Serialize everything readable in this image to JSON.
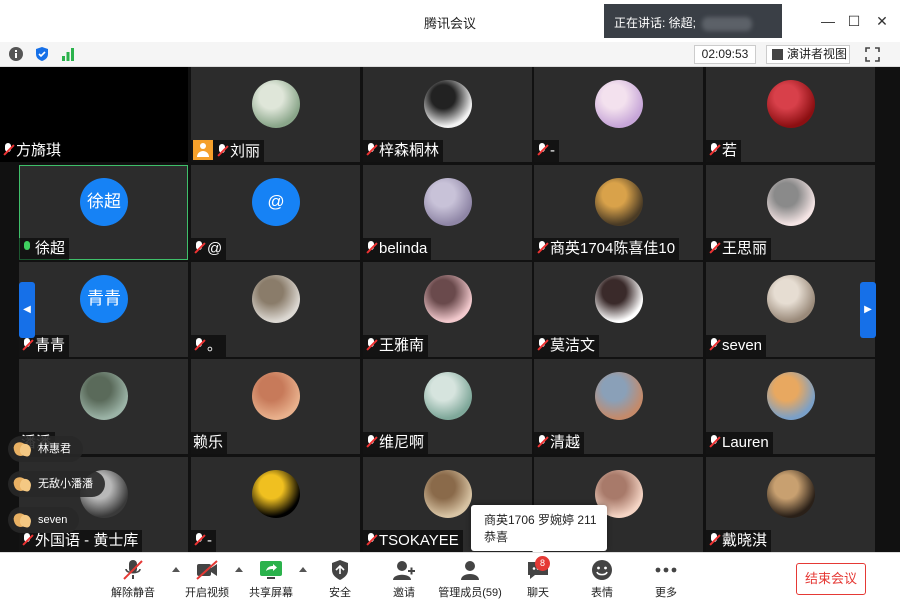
{
  "window": {
    "title": "腾讯会议",
    "speaking_label": "正在讲话: 徐超;"
  },
  "infobar": {
    "timer": "02:09:53",
    "speaker_view_label": "演讲者视图"
  },
  "tiles": [
    {
      "name": "方旖琪",
      "mic": "muted",
      "avatar_type": "none",
      "dark": true
    },
    {
      "name": "刘丽",
      "mic": "muted",
      "avatar_type": "photo",
      "host": true,
      "colors": [
        "#8aa68a",
        "#dfe6d9"
      ]
    },
    {
      "name": "梓森桐林",
      "mic": "muted",
      "avatar_type": "photo",
      "colors": [
        "#f2f2f2",
        "#222"
      ]
    },
    {
      "name": "-",
      "mic": "muted",
      "avatar_type": "photo",
      "colors": [
        "#c7a6d8",
        "#f3e1ee"
      ]
    },
    {
      "name": "若",
      "mic": "muted",
      "avatar_type": "photo",
      "colors": [
        "#8c0f12",
        "#d8404a"
      ]
    },
    {
      "name": "徐超",
      "mic": "on",
      "avatar_type": "text",
      "avatar_text": "徐超",
      "active": true
    },
    {
      "name": "@",
      "mic": "muted",
      "avatar_type": "text",
      "avatar_text": "@"
    },
    {
      "name": "belinda",
      "mic": "muted",
      "avatar_type": "photo",
      "colors": [
        "#8f86a6",
        "#c8c2d8"
      ]
    },
    {
      "name": "商英1704陈喜佳10",
      "mic": "muted",
      "avatar_type": "photo",
      "colors": [
        "#4a3b25",
        "#d9a24a"
      ]
    },
    {
      "name": "王思丽",
      "mic": "muted",
      "avatar_type": "photo",
      "colors": [
        "#f4e4e4",
        "#8a8a8a"
      ]
    },
    {
      "name": "青青",
      "mic": "muted",
      "avatar_type": "text",
      "avatar_text": "青青"
    },
    {
      "name": "。",
      "mic": "muted",
      "avatar_type": "photo",
      "colors": [
        "#dcd8d2",
        "#8a7c6a"
      ]
    },
    {
      "name": "王雅南",
      "mic": "muted",
      "avatar_type": "photo",
      "colors": [
        "#f1c8cc",
        "#6a4a4c"
      ]
    },
    {
      "name": "莫洁文",
      "mic": "muted",
      "avatar_type": "photo",
      "colors": [
        "#ffffff",
        "#3a2a2a"
      ]
    },
    {
      "name": "seven",
      "mic": "muted",
      "avatar_type": "photo",
      "colors": [
        "#9a8a7a",
        "#e6ddd2"
      ]
    },
    {
      "name": "潘潘",
      "mic": "none",
      "avatar_type": "photo",
      "colors": [
        "#9bb3a6",
        "#5a6a5a"
      ]
    },
    {
      "name": "赖乐",
      "mic": "none",
      "avatar_type": "photo",
      "colors": [
        "#e8b08c",
        "#c77a5a"
      ]
    },
    {
      "name": "维尼啊",
      "mic": "muted",
      "avatar_type": "photo",
      "colors": [
        "#7fa89a",
        "#d6e4de"
      ]
    },
    {
      "name": "清越",
      "mic": "muted",
      "avatar_type": "photo",
      "colors": [
        "#c48a6a",
        "#8aa0b8"
      ]
    },
    {
      "name": "Lauren",
      "mic": "muted",
      "avatar_type": "photo",
      "colors": [
        "#7aa0c8",
        "#e8a860"
      ]
    },
    {
      "name": "外国语 - 黄士库",
      "mic": "muted",
      "avatar_type": "photo",
      "colors": [
        "#3a3a3a",
        "#b8b8b8"
      ]
    },
    {
      "name": "-",
      "mic": "muted",
      "avatar_type": "photo",
      "colors": [
        "#000000",
        "#f0c020"
      ]
    },
    {
      "name": "TSOKAYEE",
      "mic": "muted",
      "avatar_type": "photo",
      "colors": [
        "#d8c4a4",
        "#8a6a4a"
      ]
    },
    {
      "name": "",
      "mic": "none",
      "avatar_type": "photo",
      "colors": [
        "#f4d4c4",
        "#a87a6a"
      ]
    },
    {
      "name": "戴晓淇",
      "mic": "muted",
      "avatar_type": "photo",
      "colors": [
        "#2a2018",
        "#c8a070"
      ]
    }
  ],
  "reactions": [
    "林惠君",
    "无敌小潘潘",
    "seven"
  ],
  "chat_popup": {
    "line1": "商英1706 罗婉婷 211",
    "line2": "恭喜"
  },
  "toolbar": {
    "unmute": "解除静音",
    "start_video": "开启视频",
    "share_screen": "共享屏幕",
    "security": "安全",
    "invite": "邀请",
    "manage_members": "管理成员(59)",
    "chat": "聊天",
    "chat_badge": "8",
    "emoji": "表情",
    "more": "更多",
    "end_meeting": "结束会议"
  },
  "colors": {
    "accent_blue": "#1682f5",
    "end_red": "#e53935",
    "active_green": "#3fbf6a",
    "host_orange": "#f5a02b"
  }
}
